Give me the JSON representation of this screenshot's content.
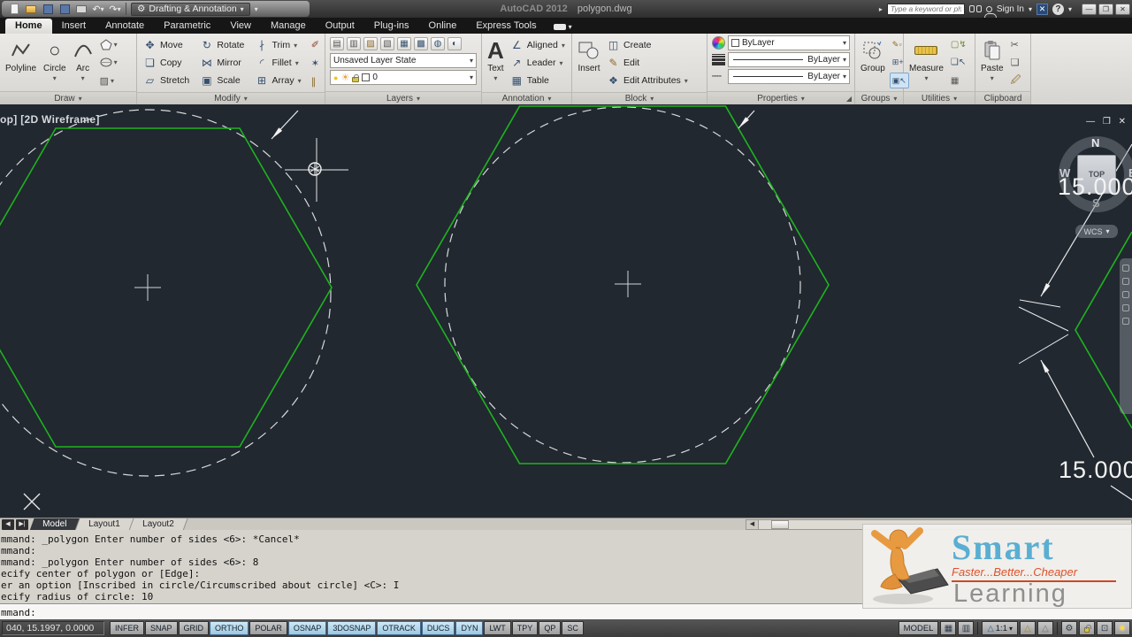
{
  "title_bar": {
    "workspace": "Drafting & Annotation",
    "app_title": "AutoCAD 2012",
    "doc_name": "polygon.dwg",
    "search_placeholder": "Type a keyword or phrase",
    "sign_in": "Sign In",
    "icons": [
      "new-file-icon",
      "open-folder-icon",
      "save-icon",
      "save-as-icon",
      "plot-icon",
      "undo-icon",
      "redo-icon",
      "workspace-gear-icon",
      "search-arrow-icon",
      "binoculars-icon",
      "user-icon",
      "exchange-icon",
      "help-icon",
      "minimize-icon",
      "restore-icon",
      "close-icon"
    ]
  },
  "ribbon": {
    "tabs": [
      "Home",
      "Insert",
      "Annotate",
      "Parametric",
      "View",
      "Manage",
      "Output",
      "Plug-ins",
      "Online",
      "Express Tools"
    ],
    "active_tab": "Home",
    "draw": {
      "label": "Draw",
      "buttons": [
        "Polyline",
        "Circle",
        "Arc"
      ],
      "small_icons": [
        "polygon-icon",
        "ellipse-icon",
        "hatch-icon"
      ]
    },
    "modify": {
      "label": "Modify",
      "items": [
        "Move",
        "Rotate",
        "Trim",
        "Copy",
        "Mirror",
        "Fillet",
        "Stretch",
        "Scale",
        "Array"
      ],
      "side_icons": [
        "erase-icon",
        "explode-icon",
        "offset-icon"
      ]
    },
    "layers": {
      "label": "Layers",
      "state_dropdown": "Unsaved Layer State",
      "current_layer": "0",
      "icon_names": [
        "layer-properties-icon",
        "layer-match-icon",
        "layer-prev-icon",
        "layer-isolate-icon",
        "layer-freeze-icon",
        "layer-off-icon",
        "layer-lock-icon",
        "layer-walk-icon"
      ]
    },
    "annotation": {
      "label": "Annotation",
      "big": "Text",
      "items": [
        "Aligned",
        "Leader",
        "Table"
      ]
    },
    "block": {
      "label": "Block",
      "big": "Insert",
      "items": [
        "Create",
        "Edit",
        "Edit Attributes"
      ]
    },
    "properties": {
      "label": "Properties",
      "color": "ByLayer",
      "lineweight": "ByLayer",
      "linetype": "ByLayer"
    },
    "groups": {
      "label": "Groups",
      "big": "Group"
    },
    "utilities": {
      "label": "Utilities",
      "big": "Measure"
    },
    "clipboard": {
      "label": "Clipboard",
      "big": "Paste"
    }
  },
  "viewport": {
    "label": "op] [2D Wireframe]",
    "viewcube": {
      "n": "N",
      "w": "W",
      "s": "S",
      "e": "E",
      "top": "TOP",
      "wcs": "WCS"
    },
    "dimension_top": "15.000",
    "dimension_bottom": "15.000",
    "geometry_colors": {
      "polygon_green": "#1eb41e",
      "construction_white": "#dcdcdc",
      "background": "#212830"
    }
  },
  "layout_tabs": {
    "items": [
      "Model",
      "Layout1",
      "Layout2"
    ],
    "active": "Model"
  },
  "command_line": {
    "history": [
      "mmand: _polygon Enter number of sides <6>: *Cancel*",
      "mmand:",
      "mmand: _polygon Enter number of sides <6>: 8",
      "ecify center of polygon or [Edge]:",
      "er an option [Inscribed in circle/Circumscribed about circle] <C>: I",
      "ecify radius of circle: 10"
    ],
    "prompt": "mmand:"
  },
  "status_bar": {
    "coordinates": "040, 15.1997, 0.0000",
    "toggles": [
      {
        "label": "INFER",
        "active": false
      },
      {
        "label": "SNAP",
        "active": false
      },
      {
        "label": "GRID",
        "active": false
      },
      {
        "label": "ORTHO",
        "active": true
      },
      {
        "label": "POLAR",
        "active": false
      },
      {
        "label": "OSNAP",
        "active": true
      },
      {
        "label": "3DOSNAP",
        "active": true
      },
      {
        "label": "OTRACK",
        "active": true
      },
      {
        "label": "DUCS",
        "active": true
      },
      {
        "label": "DYN",
        "active": true
      },
      {
        "label": "LWT",
        "active": false
      },
      {
        "label": "TPY",
        "active": false
      },
      {
        "label": "QP",
        "active": false
      },
      {
        "label": "SC",
        "active": false
      }
    ],
    "model_label": "MODEL",
    "annotation_scale": "1:1"
  },
  "logo": {
    "title": "Smart",
    "tagline": "Faster...Better...Cheaper",
    "subtitle": "Learning"
  }
}
